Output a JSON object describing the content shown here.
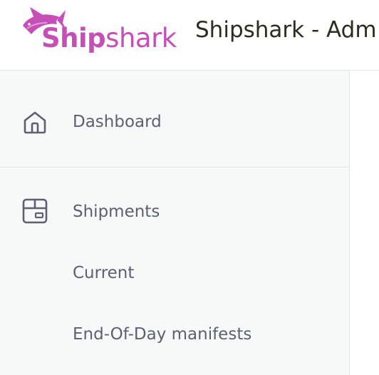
{
  "header": {
    "logo": {
      "text_bold": "Ship",
      "text_light": "shark",
      "color": "#c54fb6"
    },
    "title": "Shipshark - Adm"
  },
  "sidebar": {
    "items": [
      {
        "label": "Dashboard",
        "icon": "home-icon"
      },
      {
        "label": "Shipments",
        "icon": "package-icon"
      },
      {
        "label": "Current"
      },
      {
        "label": "End-Of-Day manifests"
      }
    ]
  },
  "colors": {
    "sidebar_bg": "#f7f8f8",
    "nav_text": "#5b6171",
    "title_text": "#2b2e1f",
    "brand": "#c54fb6"
  }
}
